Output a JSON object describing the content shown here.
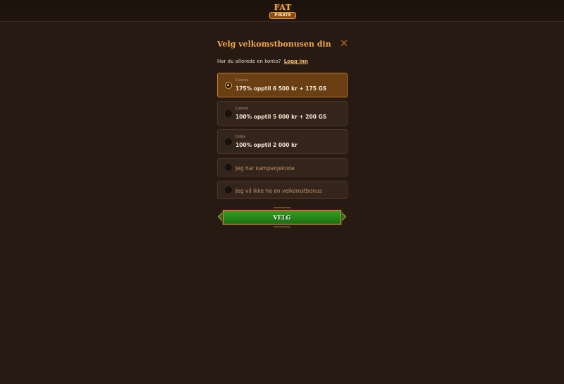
{
  "header": {
    "logo_top": "FAT",
    "logo_bottom": "PIRATE"
  },
  "modal": {
    "title": "Velg velkomstbonusen din",
    "close_icon": "close-icon",
    "login_prompt": "Har du allerede en konto?",
    "login_link": "Logg inn",
    "options": [
      {
        "category": "Casino",
        "label": "175% opptil 6 500 kr + 175 GS",
        "selected": true
      },
      {
        "category": "Casino",
        "label": "100% opptil 5 000 kr + 200 GS",
        "selected": false
      },
      {
        "category": "Odds",
        "label": "100% opptil 2 000 kr",
        "selected": false
      },
      {
        "label": "Jeg har kampanjekode",
        "selected": false
      },
      {
        "label": "Jeg vil ikke ha en velkomstbonus",
        "selected": false
      }
    ],
    "submit_label": "VELG"
  },
  "colors": {
    "background": "#261a13",
    "accent": "#f2a548",
    "selected_option": "#6b3f14",
    "button_green": "#2ea01e"
  }
}
